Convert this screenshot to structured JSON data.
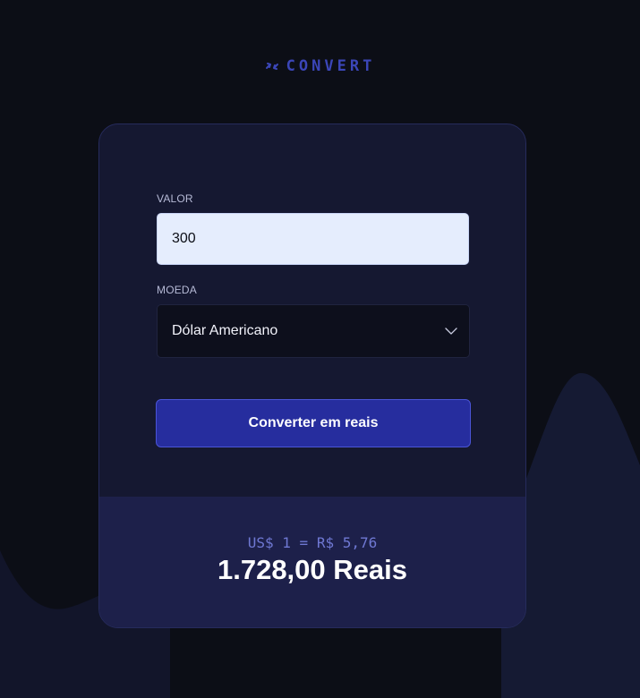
{
  "brand": {
    "name": "CONVERT",
    "icon": "swap-arrows-icon",
    "color": "#3b46b8"
  },
  "form": {
    "amount_label": "VALOR",
    "amount_value": "300",
    "currency_label": "MOEDA",
    "currency_selected": "Dólar Americano",
    "submit_label": "Converter em reais"
  },
  "result": {
    "rate_text": "US$ 1 = R$ 5,76",
    "total_text": "1.728,00 Reais"
  },
  "colors": {
    "background": "#0c0e16",
    "card": "#151831",
    "result_panel": "#1d204a",
    "button": "#262d9e",
    "input": "#e5edfd",
    "rate_text": "#6f78d3"
  }
}
